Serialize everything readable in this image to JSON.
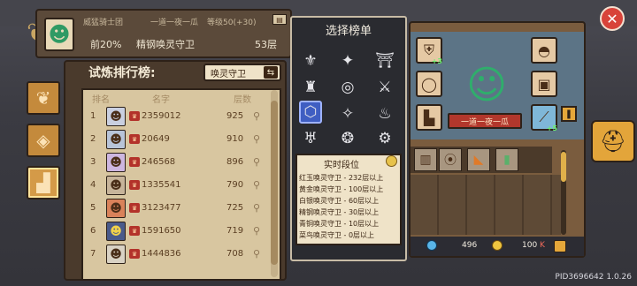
{
  "player": {
    "guild": "威猛骑士团",
    "name": "一道一夜一瓜",
    "level": "等级50(+30)",
    "percent": "前20%",
    "mode": "精钢唤灵守卫",
    "floor": "53层"
  },
  "board": {
    "title": "试炼排行榜:",
    "type": "唤灵守卫",
    "columns": {
      "rank": "排名",
      "name": "名字",
      "floors": "层数"
    },
    "rows": [
      {
        "rank": "1",
        "pid": "2359012",
        "score": "925"
      },
      {
        "rank": "2",
        "pid": "20649",
        "score": "910"
      },
      {
        "rank": "3",
        "pid": "246568",
        "score": "896"
      },
      {
        "rank": "4",
        "pid": "1335541",
        "score": "790"
      },
      {
        "rank": "5",
        "pid": "3123477",
        "score": "725"
      },
      {
        "rank": "6",
        "pid": "1591650",
        "score": "719"
      },
      {
        "rank": "7",
        "pid": "1444836",
        "score": "708"
      }
    ]
  },
  "select": {
    "title": "选择榜单",
    "realtime_title": "实时段位",
    "tiers": [
      "红玉唤灵守卫 - 232层以上",
      "黄金唤灵守卫 - 100层以上",
      "白银唤灵守卫 - 60层以上",
      "精钢唤灵守卫 - 30层以上",
      "青铜唤灵守卫 - 10层以上",
      "菜鸟唤灵守卫 - 0层以上"
    ]
  },
  "character": {
    "name_plate": "一道一夜一瓜",
    "slot_plus_a": "+3",
    "slot_plus_b": "+5"
  },
  "currency": {
    "gems": "496",
    "gold": "100",
    "gold_mult": "K"
  },
  "footer": {
    "id_version": "PID3696642 1.0.26"
  }
}
